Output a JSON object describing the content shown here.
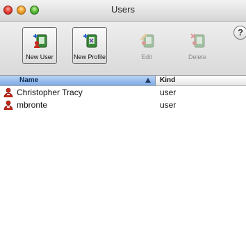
{
  "window": {
    "title": "Users"
  },
  "toolbar": {
    "new_user": {
      "label": "New User",
      "icon": "new-user-icon",
      "enabled": true
    },
    "new_profile": {
      "label": "New Profile",
      "icon": "new-profile-icon",
      "enabled": true
    },
    "edit": {
      "label": "Edit",
      "icon": "edit-user-icon",
      "enabled": false
    },
    "delete": {
      "label": "Delete",
      "icon": "delete-user-icon",
      "enabled": false
    },
    "help": {
      "label": "?"
    }
  },
  "list": {
    "columns": {
      "name": "Name",
      "kind": "Kind"
    },
    "rows": [
      {
        "name": "Christopher Tracy",
        "kind": "user",
        "icon": "user-icon"
      },
      {
        "name": "mbronte",
        "kind": "user",
        "icon": "user-icon"
      }
    ]
  },
  "colors": {
    "accent": "#7eaae6",
    "user_icon": "#c62a1e"
  }
}
